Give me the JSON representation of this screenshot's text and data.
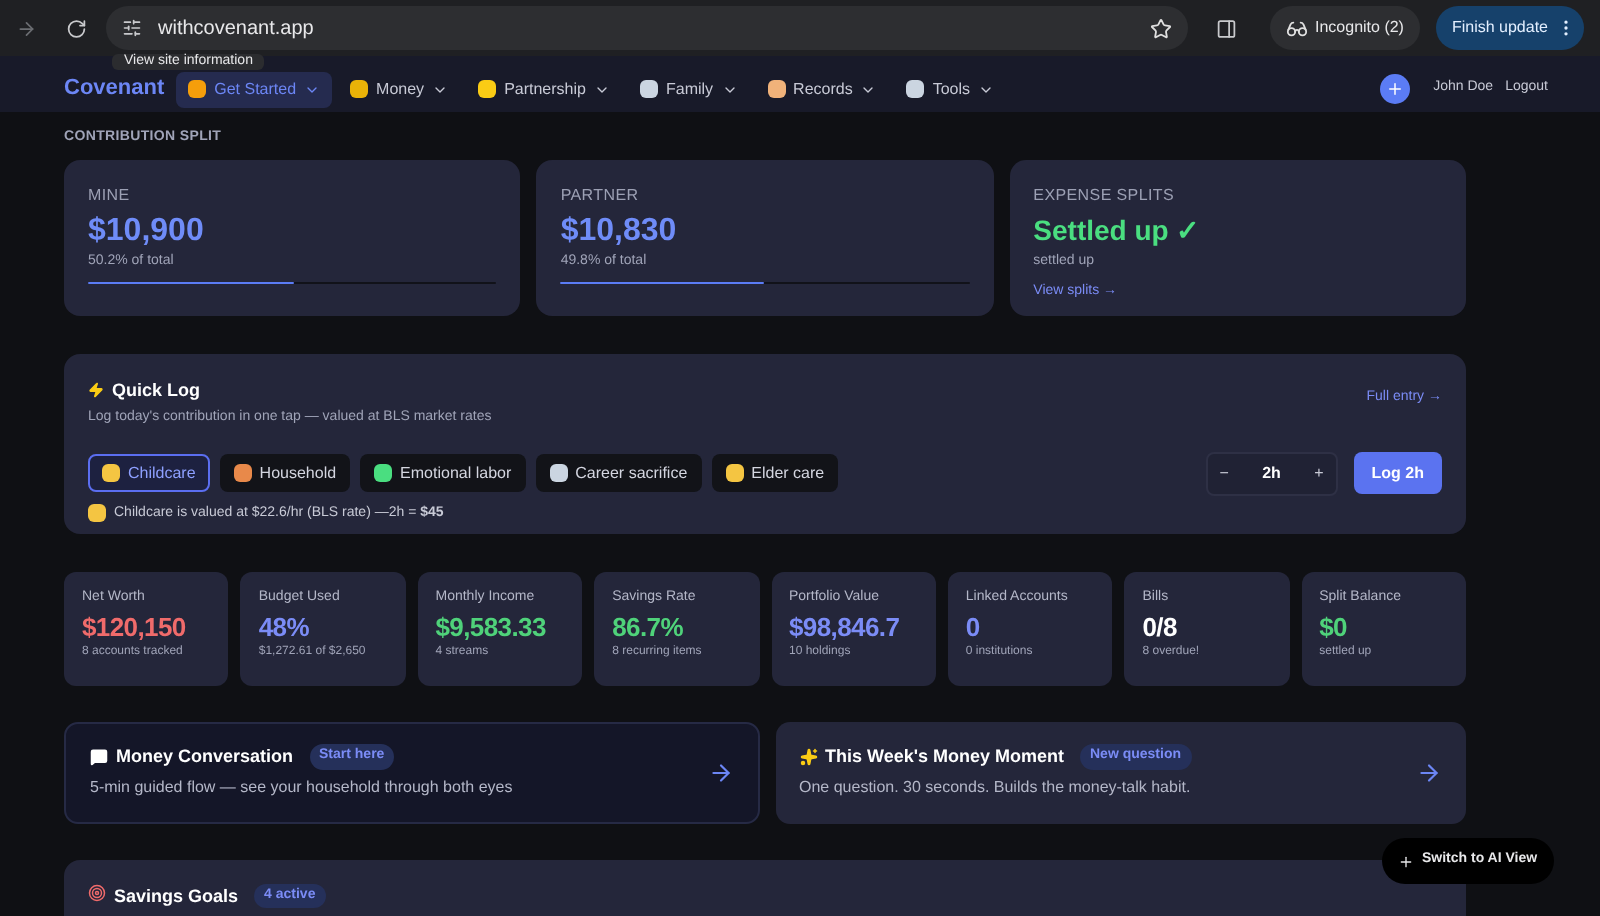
{
  "browser": {
    "url": "withcovenant.app",
    "tooltip": "View site information",
    "incognito": "Incognito (2)",
    "update": "Finish update"
  },
  "nav": {
    "logo": "Covenant",
    "items": [
      {
        "label": "Get Started",
        "selected": true
      },
      {
        "label": "Money",
        "selected": false
      },
      {
        "label": "Partnership",
        "selected": false
      },
      {
        "label": "Family",
        "selected": false
      },
      {
        "label": "Records",
        "selected": false
      },
      {
        "label": "Tools",
        "selected": false
      }
    ],
    "user": "John Doe",
    "logout": "Logout"
  },
  "contribution": {
    "heading": "CONTRIBUTION SPLIT",
    "cards": [
      {
        "kind": "share",
        "label": "MINE",
        "value": "$10,900",
        "caption": "50.2% of total",
        "level": 0.502
      },
      {
        "kind": "share",
        "label": "PARTNER",
        "value": "$10,830",
        "caption": "49.8% of total",
        "level": 0.498
      },
      {
        "kind": "status",
        "label": "EXPENSE SPLITS",
        "value": "Settled up ✓",
        "caption": "settled up",
        "link": "View splits →"
      }
    ]
  },
  "quick_log": {
    "title": "Quick Log",
    "subtitle": "Log today's contribution in one tap — valued at BLS market rates",
    "full_entry": "Full entry →",
    "categories": [
      {
        "label": "Childcare",
        "selected": true
      },
      {
        "label": "Household",
        "selected": false
      },
      {
        "label": "Emotional labor",
        "selected": false
      },
      {
        "label": "Career sacrifice",
        "selected": false
      },
      {
        "label": "Elder care",
        "selected": false
      }
    ],
    "note": "Childcare is valued at $22.6/hr (BLS rate) —2h = **$45**",
    "minus": "−",
    "hours": "2h",
    "plus": "+",
    "log_button": "Log 2h"
  },
  "stats": [
    {
      "label": "Net Worth",
      "value": "$120,150",
      "caption": "8 accounts tracked",
      "color": "#f06b6b"
    },
    {
      "label": "Budget Used",
      "value": "48%",
      "caption": "$1,272.61 of $2,650",
      "color": "#7b8cf6"
    },
    {
      "label": "Monthly Income",
      "value": "$9,583.33",
      "caption": "4 streams",
      "color": "#4fd27a"
    },
    {
      "label": "Savings Rate",
      "value": "86.7%",
      "caption": "8 recurring items",
      "color": "#4fd27a"
    },
    {
      "label": "Portfolio Value",
      "value": "$98,846.7",
      "caption": "10 holdings",
      "color": "#7b8cf6"
    },
    {
      "label": "Linked Accounts",
      "value": "0",
      "caption": "0 institutions",
      "color": "#7b8cf6"
    },
    {
      "label": "Bills",
      "value": "0/8",
      "caption": "8 overdue!",
      "color": "#ffffff"
    },
    {
      "label": "Split Balance",
      "value": "$0",
      "caption": "settled up",
      "color": "#4fd27a"
    }
  ],
  "prompts": [
    {
      "title": "Money Conversation",
      "badge": "Start here",
      "text": "5-min guided flow — see your household through both eyes"
    },
    {
      "title": "This Week's Money Moment",
      "badge": "New question",
      "text": "One question. 30 seconds. Builds the money-talk habit."
    }
  ],
  "savings_goals": {
    "title": "Savings Goals",
    "badge": "4 active"
  },
  "ai_button": "Switch to AI View"
}
